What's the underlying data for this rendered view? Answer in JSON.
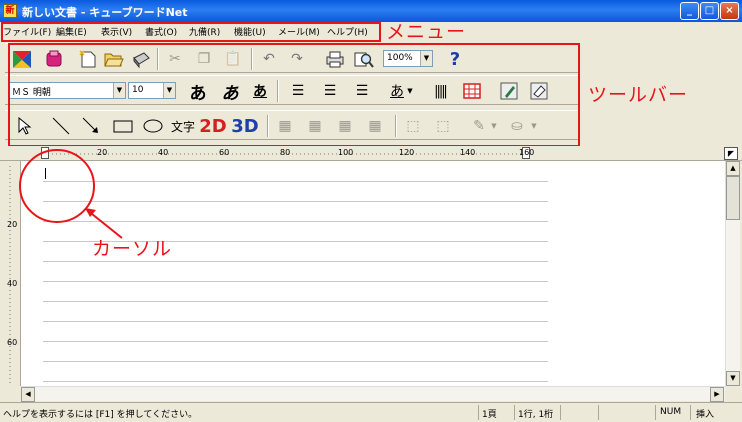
{
  "window": {
    "title": "新しい文書 - キューブワードNet",
    "minimize": "_",
    "maximize": "□",
    "close": "×"
  },
  "menu": [
    "ファイル(F)",
    "編集(E)",
    "表示(V)",
    "書式(O)",
    "九備(R)",
    "機能(U)",
    "メール(M)",
    "ヘルプ(H)"
  ],
  "toolbar": {
    "zoom": "100%",
    "font_name": "ＭＳ 明朝",
    "font_size": "10",
    "bold_label": "あ",
    "italic_label": "あ",
    "underline_label": "あ",
    "color_label": "あ",
    "text_label": "文字",
    "text2d_label": "2D",
    "text3d_label": "3D",
    "help_label": "?"
  },
  "ruler": {
    "marks": [
      "20",
      "40",
      "60",
      "80",
      "100",
      "120",
      "140",
      "160"
    ]
  },
  "vruler": {
    "marks": [
      "20",
      "40",
      "60"
    ]
  },
  "annotations": {
    "menu": "メニュー",
    "toolbar": "ツールバー",
    "cursor": "カーソル"
  },
  "status": {
    "help": "ヘルプを表示するには [F1] を押してください。",
    "page": "1頁",
    "position": "1行, 1桁",
    "num": "NUM",
    "insert": "挿入"
  },
  "colors": {
    "title_bar": "#0A5ADF",
    "annotation": "#E8141A"
  }
}
